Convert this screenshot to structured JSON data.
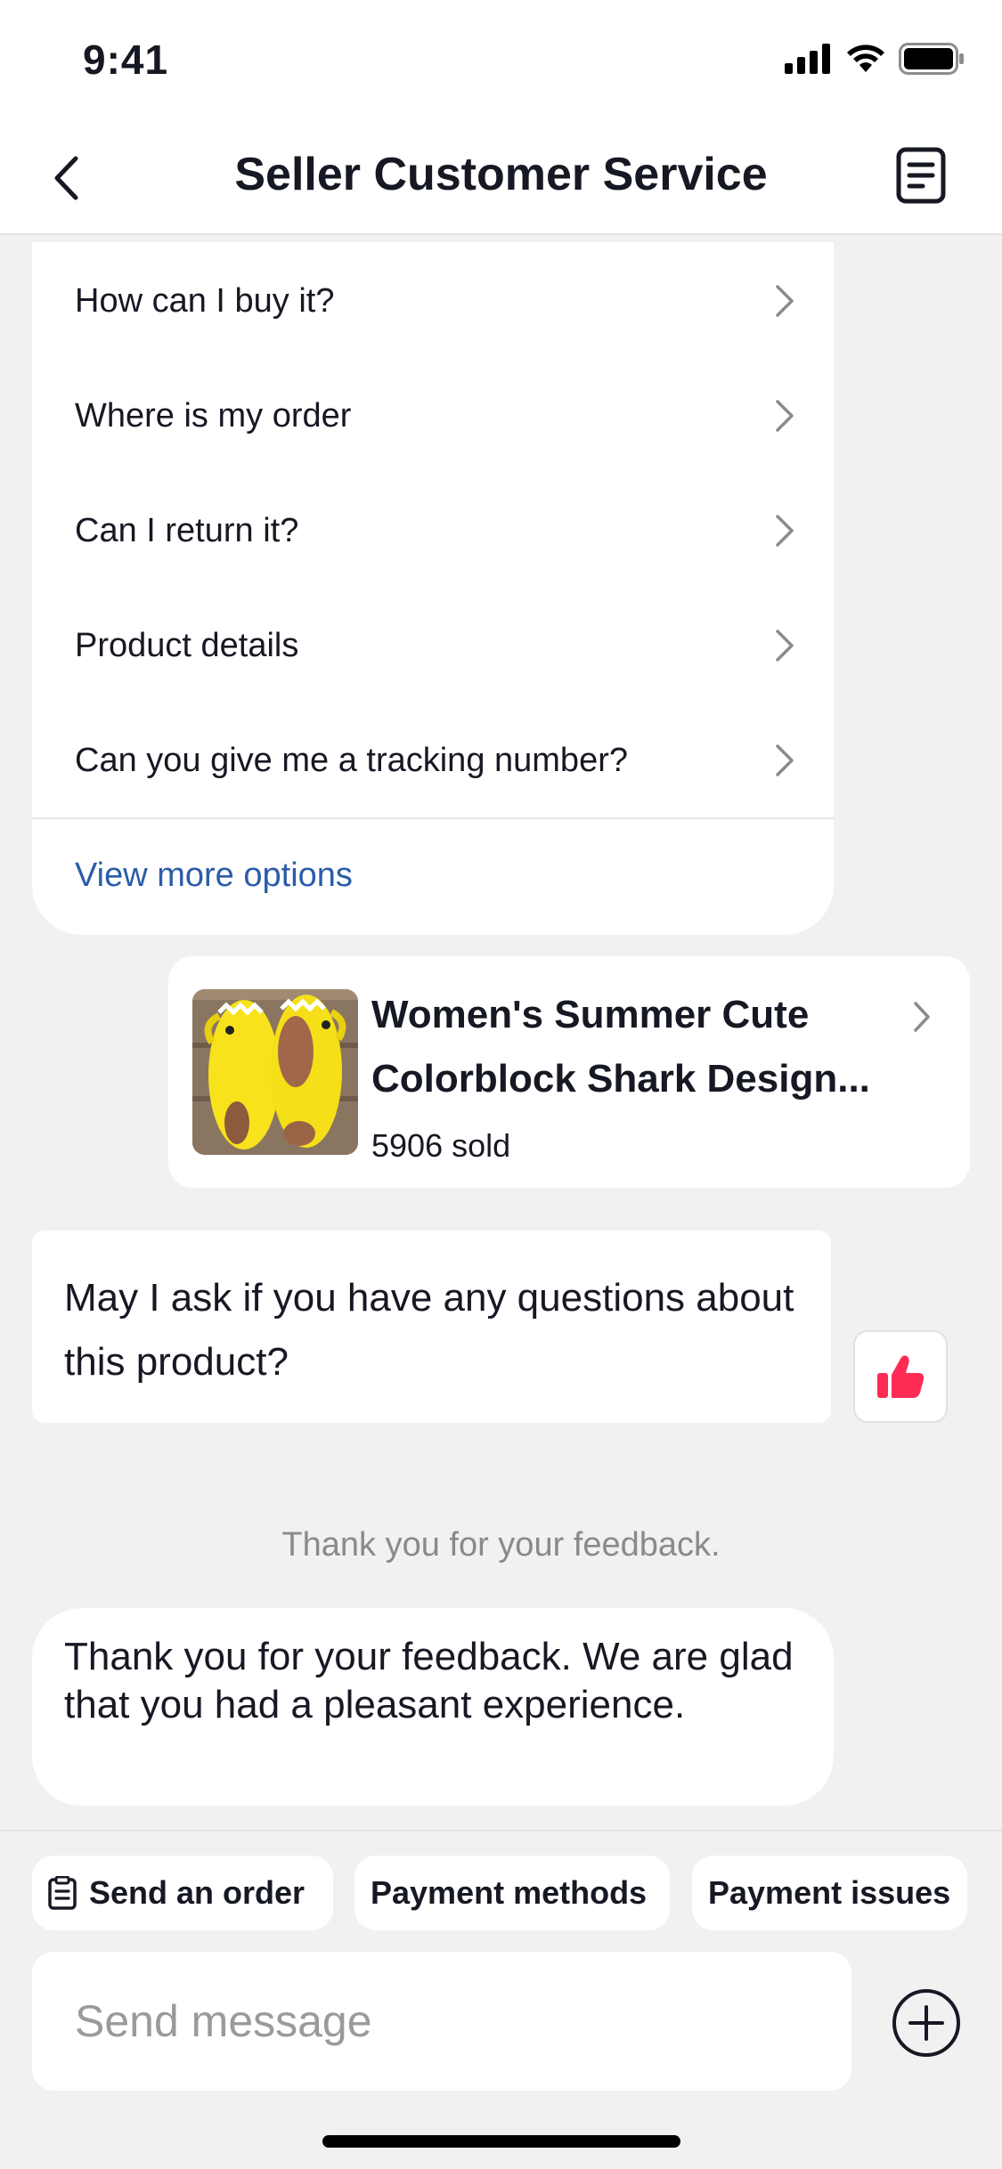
{
  "status_bar": {
    "time": "9:41"
  },
  "header": {
    "title": "Seller Customer Service"
  },
  "faq": {
    "items": [
      {
        "label": "How can I buy it?"
      },
      {
        "label": "Where is my order"
      },
      {
        "label": "Can I return it?"
      },
      {
        "label": "Product details"
      },
      {
        "label": "Can you give me a tracking number?"
      }
    ],
    "view_more": "View more options"
  },
  "product": {
    "title": "Women's Summer Cute Colorblock Shark Design...",
    "sold": "5906 sold"
  },
  "messages": {
    "question": "May I ask if you have any questions about this product?",
    "system_note": "Thank you for your feedback.",
    "reply": "Thank you for your feedback. We are glad that you had a pleasant experience."
  },
  "quick_actions": [
    {
      "label": "Send an order",
      "icon": "order-icon"
    },
    {
      "label": "Payment methods"
    },
    {
      "label": "Payment issues"
    }
  ],
  "composer": {
    "placeholder": "Send message"
  },
  "colors": {
    "link": "#2b5ca8",
    "like": "#fe2c55",
    "text": "#161823"
  }
}
